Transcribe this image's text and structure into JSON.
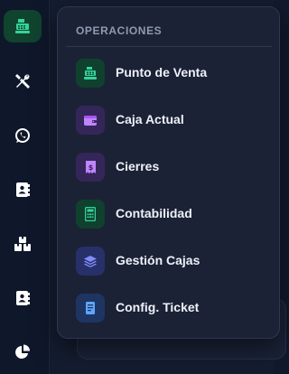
{
  "flyout": {
    "header": "OPERACIONES",
    "items": [
      {
        "label": "Punto de Venta",
        "icon": "cash-register-icon",
        "icon_bg": "#10412e",
        "icon_color": "#34d399"
      },
      {
        "label": "Caja Actual",
        "icon": "wallet-icon",
        "icon_bg": "#35265a",
        "icon_color": "#c084fc"
      },
      {
        "label": "Cierres",
        "icon": "receipt-icon",
        "icon_bg": "#35265a",
        "icon_color": "#c084fc"
      },
      {
        "label": "Contabilidad",
        "icon": "calculator-icon",
        "icon_bg": "#10412e",
        "icon_color": "#34d399"
      },
      {
        "label": "Gestión Cajas",
        "icon": "layers-icon",
        "icon_bg": "#28306a",
        "icon_color": "#818cf8"
      },
      {
        "label": "Config. Ticket",
        "icon": "ticket-icon",
        "icon_bg": "#1e3563",
        "icon_color": "#60a5fa"
      }
    ]
  },
  "sidebar": {
    "items": [
      {
        "icon": "cash-register-icon",
        "active": true,
        "color": "#34d399"
      },
      {
        "icon": "tools-icon",
        "active": false,
        "color": "#ffffff"
      },
      {
        "icon": "whatsapp-icon",
        "active": false,
        "color": "#ffffff"
      },
      {
        "icon": "contacts-icon",
        "active": false,
        "color": "#ffffff"
      },
      {
        "icon": "boxes-icon",
        "active": false,
        "color": "#ffffff"
      },
      {
        "icon": "address-book-icon",
        "active": false,
        "color": "#ffffff"
      },
      {
        "icon": "pie-chart-icon",
        "active": false,
        "color": "#ffffff"
      }
    ]
  },
  "colors": {
    "sidebar_bg": "#0f172a",
    "flyout_bg": "#1b2236",
    "accent": "#34d399"
  }
}
